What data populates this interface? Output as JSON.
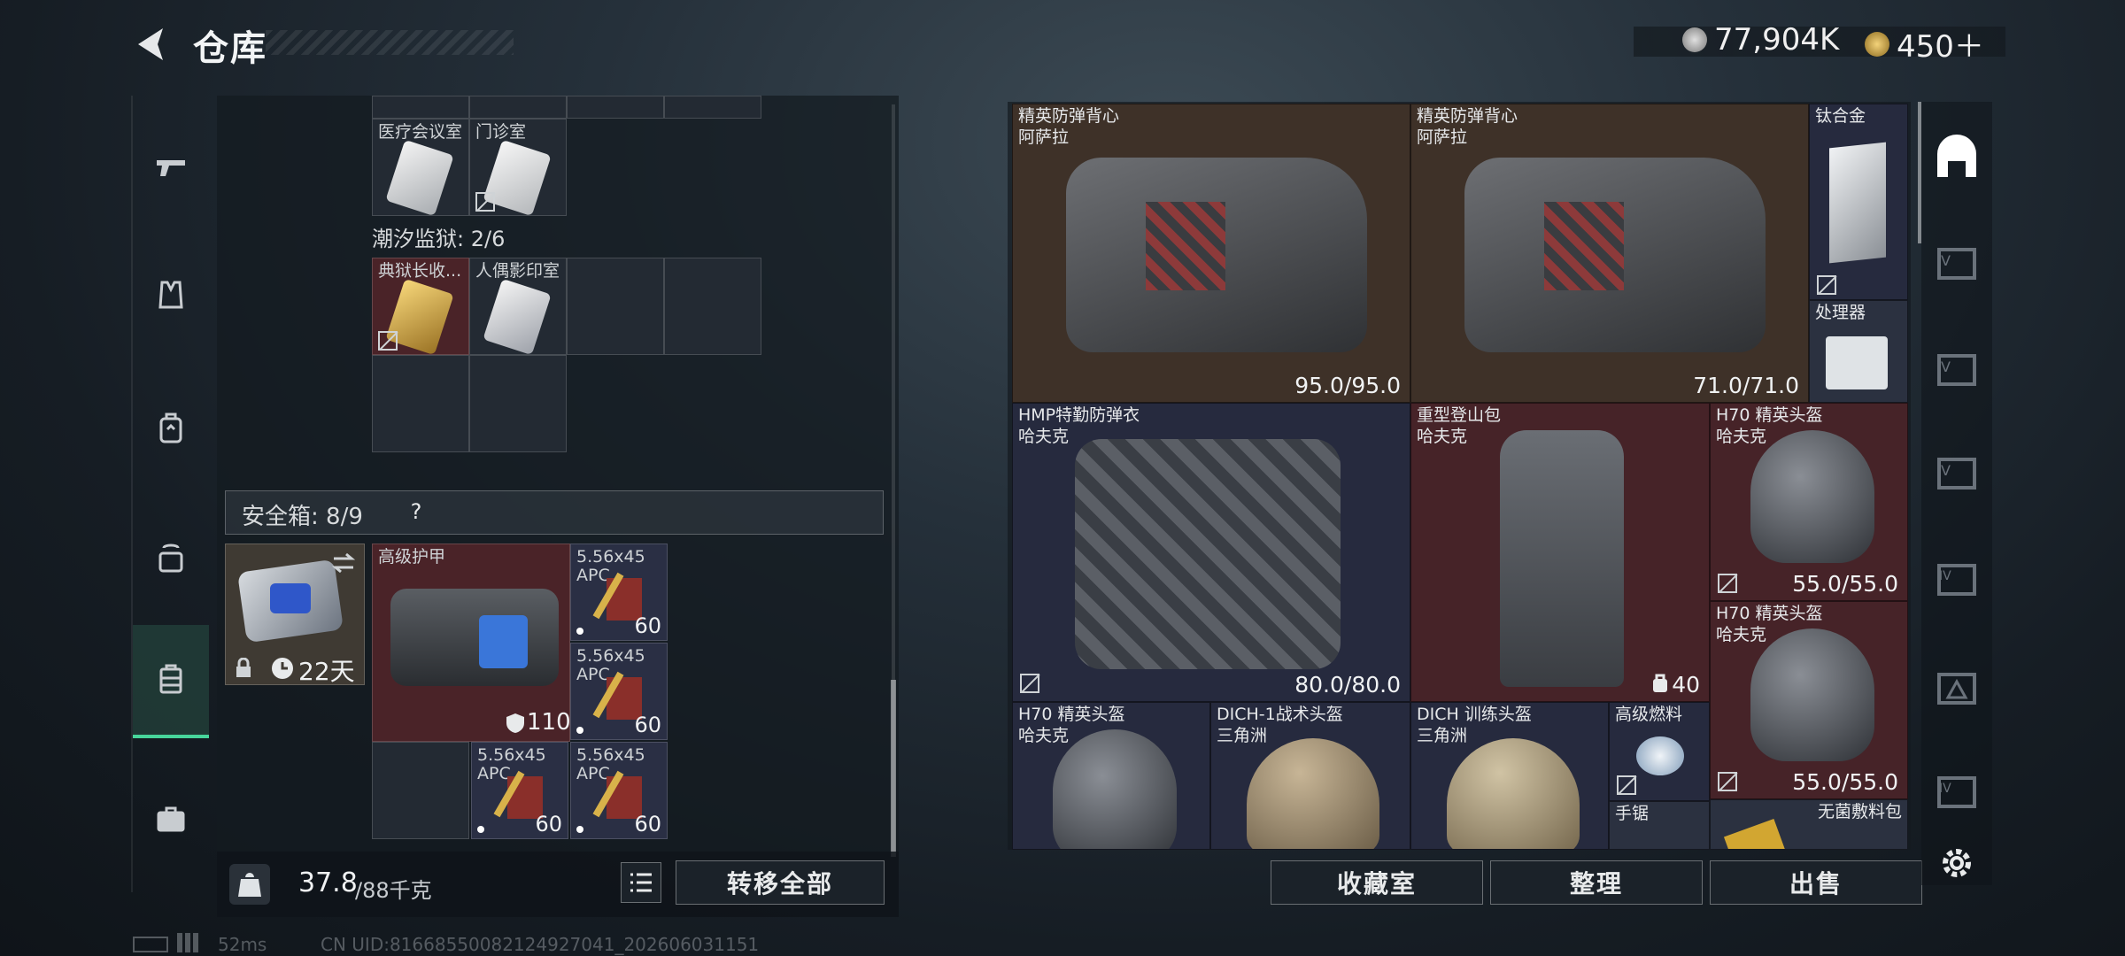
{
  "header": {
    "title": "仓库"
  },
  "currency": {
    "silver": "77,904K",
    "gold": "450＋"
  },
  "left_nav": [
    "gun-icon",
    "armor-vest-icon",
    "backpack-icon",
    "chest-rig-icon",
    "safebox-icon",
    "briefcase-icon"
  ],
  "stash": {
    "top_cells": [
      {
        "label": "医疗会议室"
      },
      {
        "label": "门诊室"
      }
    ],
    "prison_section": "潮汐监狱: 2/6",
    "prison_cells": [
      {
        "label": "典狱长收..."
      },
      {
        "label": "人偶影印室"
      }
    ]
  },
  "safebox": {
    "title": "安全箱: 8/9",
    "help": "?",
    "timer": "22天",
    "items": [
      {
        "name": "高级护甲",
        "value": "110"
      },
      {
        "name": "5.56x45 APC",
        "count": "60"
      },
      {
        "name": "5.56x45 APC",
        "count": "60"
      },
      {
        "name": "5.56x45 APC",
        "count": "60"
      },
      {
        "name": "5.56x45 APC",
        "count": "60"
      }
    ]
  },
  "weight": {
    "current": "37.8",
    "max": "/88千克"
  },
  "buttons": {
    "transfer_all": "转移全部",
    "collection": "收藏室",
    "organize": "整理",
    "sell": "出售"
  },
  "inventory": [
    {
      "name": "精英防弹背心",
      "sub": "阿萨拉",
      "durability": "95.0/95.0"
    },
    {
      "name": "精英防弹背心",
      "sub": "阿萨拉",
      "durability": "71.0/71.0"
    },
    {
      "name": "钛合金"
    },
    {
      "name": "处理器"
    },
    {
      "name": "HMP特勤防弹衣",
      "sub": "哈夫克",
      "durability": "80.0/80.0"
    },
    {
      "name": "重型登山包",
      "sub": "哈夫克",
      "capacity": "40"
    },
    {
      "name": "H70 精英头盔",
      "sub": "哈夫克",
      "durability": "55.0/55.0"
    },
    {
      "name": "H70 精英头盔",
      "sub": "哈夫克",
      "durability": "55.0/55.0"
    },
    {
      "name": "H70 精英头盔",
      "sub": "哈夫克"
    },
    {
      "name": "DICH-1战术头盔",
      "sub": "三角洲"
    },
    {
      "name": "DICH 训练头盔",
      "sub": "三角洲"
    },
    {
      "name": "高级燃料"
    },
    {
      "name": "手锯"
    },
    {
      "name": "无菌敷料包"
    }
  ],
  "footer": {
    "ping": "52ms",
    "uid": "CN UID:81668550082124927041_202606031151"
  },
  "colors": {
    "accent": "#47d59b",
    "item_red": "#462328",
    "item_brown": "#3e3128",
    "item_navy": "#262a3e"
  }
}
